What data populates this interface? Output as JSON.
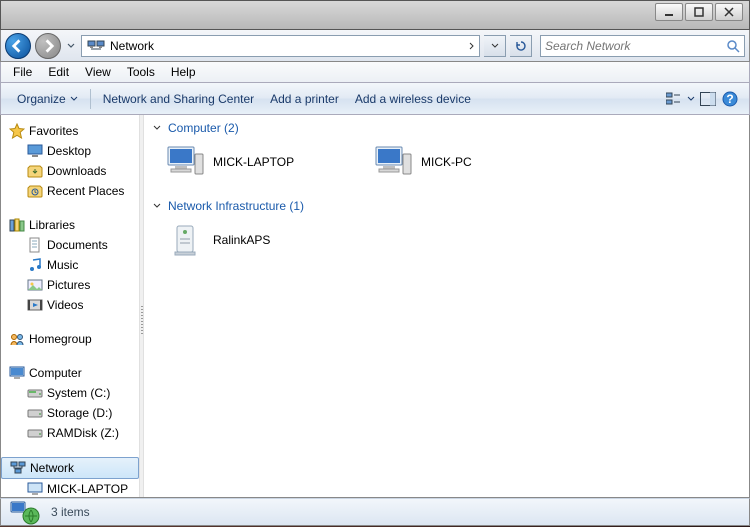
{
  "window": {
    "title": "Network"
  },
  "nav": {
    "location": "Network",
    "search_placeholder": "Search Network"
  },
  "menubar": [
    "File",
    "Edit",
    "View",
    "Tools",
    "Help"
  ],
  "cmdbar": {
    "organize": "Organize",
    "nsc": "Network and Sharing Center",
    "add_printer": "Add a printer",
    "add_wireless": "Add a wireless device"
  },
  "tree": {
    "favorites": {
      "label": "Favorites",
      "items": [
        "Desktop",
        "Downloads",
        "Recent Places"
      ]
    },
    "libraries": {
      "label": "Libraries",
      "items": [
        "Documents",
        "Music",
        "Pictures",
        "Videos"
      ]
    },
    "homegroup": {
      "label": "Homegroup"
    },
    "computer": {
      "label": "Computer",
      "items": [
        "System (C:)",
        "Storage (D:)",
        "RAMDisk (Z:)"
      ]
    },
    "network": {
      "label": "Network",
      "items": [
        "MICK-LAPTOP"
      ]
    }
  },
  "content": {
    "groups": [
      {
        "label": "Computer (2)",
        "items": [
          "MICK-LAPTOP",
          "MICK-PC"
        ],
        "type": "computer"
      },
      {
        "label": "Network Infrastructure (1)",
        "items": [
          "RalinkAPS"
        ],
        "type": "device"
      }
    ]
  },
  "status": {
    "text": "3 items"
  }
}
